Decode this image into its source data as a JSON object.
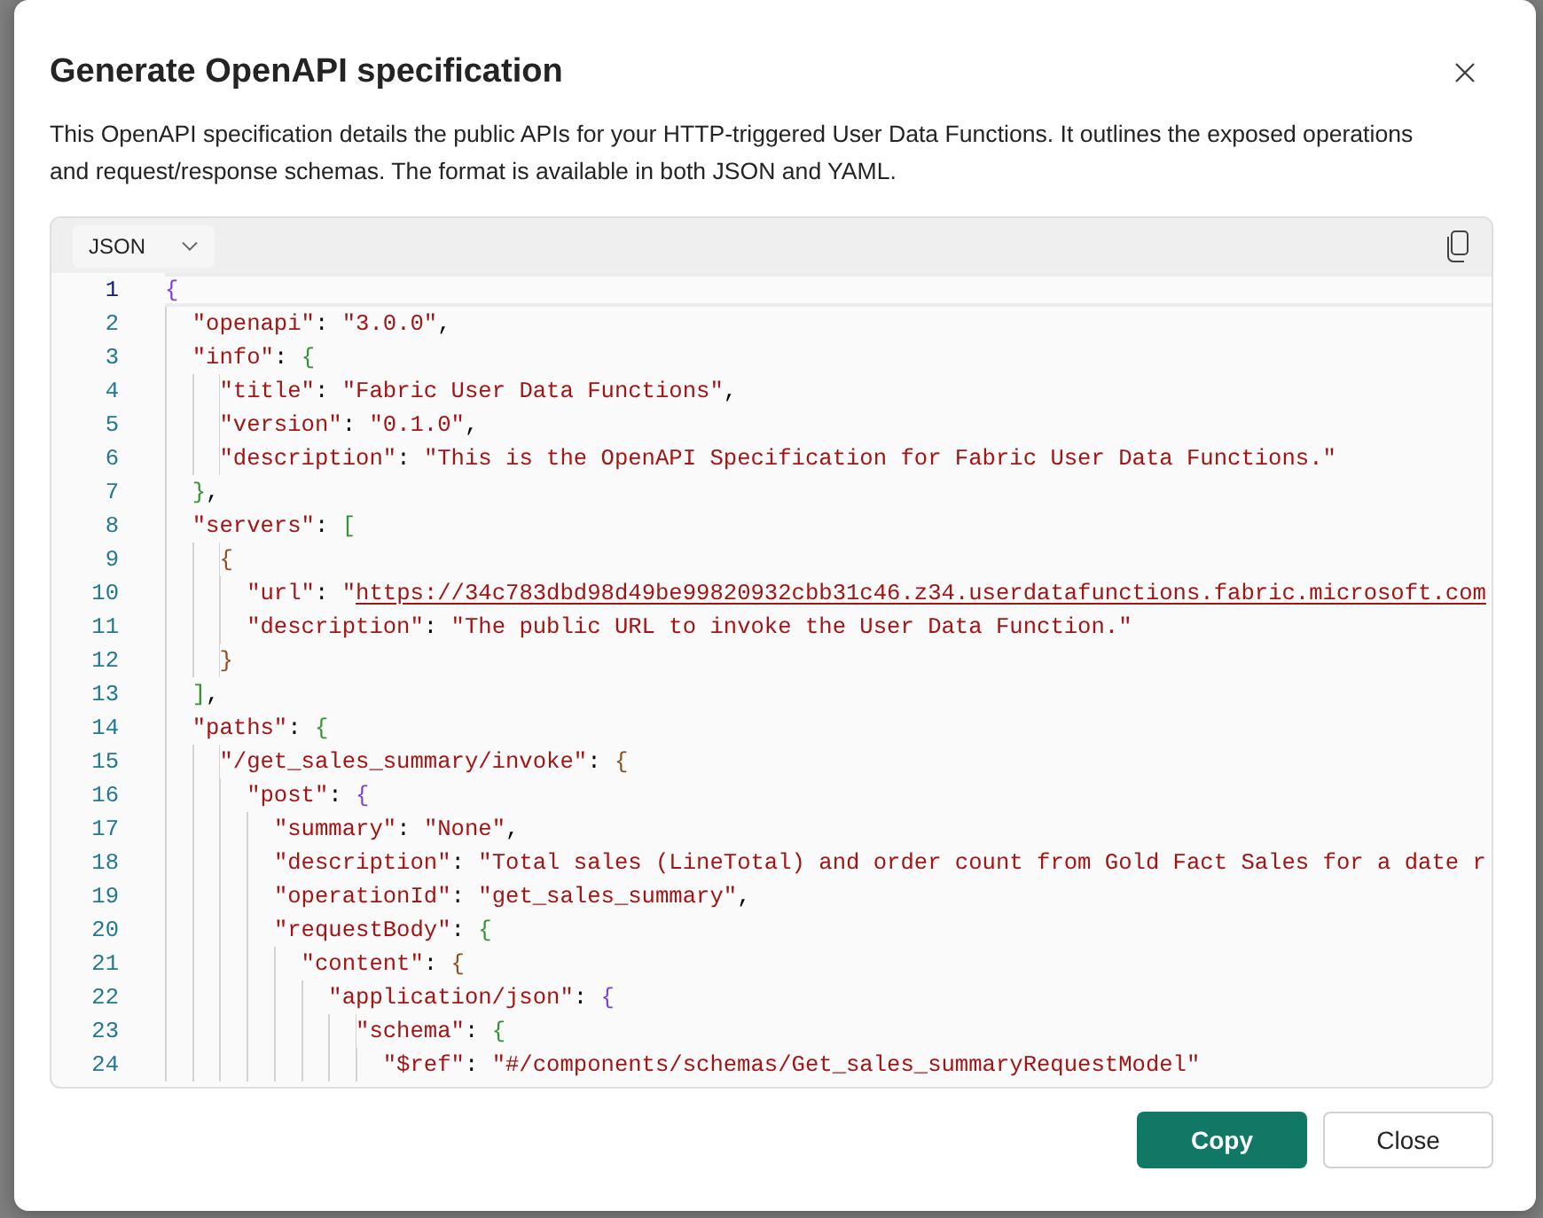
{
  "dialog": {
    "title": "Generate OpenAPI specification",
    "description": "This OpenAPI specification details the public APIs for your HTTP-triggered User Data Functions. It outlines the exposed operations and request/response schemas. The format is available in both JSON and YAML."
  },
  "editor": {
    "format_dropdown": {
      "value": "JSON"
    },
    "lines": [
      {
        "number": "1",
        "code": "{",
        "current": true,
        "link": false
      },
      {
        "number": "2",
        "code": "  \"openapi\": \"3.0.0\",",
        "current": false,
        "link": false
      },
      {
        "number": "3",
        "code": "  \"info\": {",
        "current": false,
        "link": false
      },
      {
        "number": "4",
        "code": "    \"title\": \"Fabric User Data Functions\",",
        "current": false,
        "link": false
      },
      {
        "number": "5",
        "code": "    \"version\": \"0.1.0\",",
        "current": false,
        "link": false
      },
      {
        "number": "6",
        "code": "    \"description\": \"This is the OpenAPI Specification for Fabric User Data Functions.\"",
        "current": false,
        "link": false
      },
      {
        "number": "7",
        "code": "  },",
        "current": false,
        "link": false
      },
      {
        "number": "8",
        "code": "  \"servers\": [",
        "current": false,
        "link": false
      },
      {
        "number": "9",
        "code": "    {",
        "current": false,
        "link": false
      },
      {
        "number": "10",
        "code": "      \"url\": \"https://34c783dbd98d49be99820932cbb31c46.z34.userdatafunctions.fabric.microsoft.com",
        "current": false,
        "link": true
      },
      {
        "number": "11",
        "code": "      \"description\": \"The public URL to invoke the User Data Function.\"",
        "current": false,
        "link": false
      },
      {
        "number": "12",
        "code": "    }",
        "current": false,
        "link": false
      },
      {
        "number": "13",
        "code": "  ],",
        "current": false,
        "link": false
      },
      {
        "number": "14",
        "code": "  \"paths\": {",
        "current": false,
        "link": false
      },
      {
        "number": "15",
        "code": "    \"/get_sales_summary/invoke\": {",
        "current": false,
        "link": false
      },
      {
        "number": "16",
        "code": "      \"post\": {",
        "current": false,
        "link": false
      },
      {
        "number": "17",
        "code": "        \"summary\": \"None\",",
        "current": false,
        "link": false
      },
      {
        "number": "18",
        "code": "        \"description\": \"Total sales (LineTotal) and order count from Gold Fact Sales for a date r",
        "current": false,
        "link": false
      },
      {
        "number": "19",
        "code": "        \"operationId\": \"get_sales_summary\",",
        "current": false,
        "link": false
      },
      {
        "number": "20",
        "code": "        \"requestBody\": {",
        "current": false,
        "link": false
      },
      {
        "number": "21",
        "code": "          \"content\": {",
        "current": false,
        "link": false
      },
      {
        "number": "22",
        "code": "            \"application/json\": {",
        "current": false,
        "link": false
      },
      {
        "number": "23",
        "code": "              \"schema\": {",
        "current": false,
        "link": false
      },
      {
        "number": "24",
        "code": "                \"$ref\": \"#/components/schemas/Get_sales_summaryRequestModel\"",
        "current": false,
        "link": false
      }
    ]
  },
  "buttons": [
    {
      "label": "Copy",
      "kind": "primary"
    },
    {
      "label": "Close",
      "kind": "secondary"
    }
  ]
}
